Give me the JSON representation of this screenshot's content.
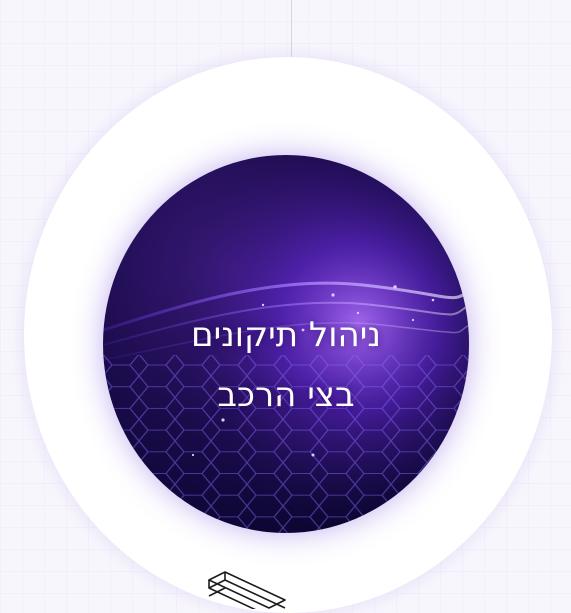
{
  "card": {
    "title_line1": "ניהול תיקונים",
    "title_line2": "בצי הרכב"
  },
  "colors": {
    "background": "#f8f6fd",
    "ring": "#ffffff",
    "circle_dark": "#0b0630",
    "circle_glow": "#7a3cff",
    "text": "#ffffff"
  },
  "icons": {
    "connector": "vertical-connector-line",
    "device": "stacked-device-icon"
  }
}
